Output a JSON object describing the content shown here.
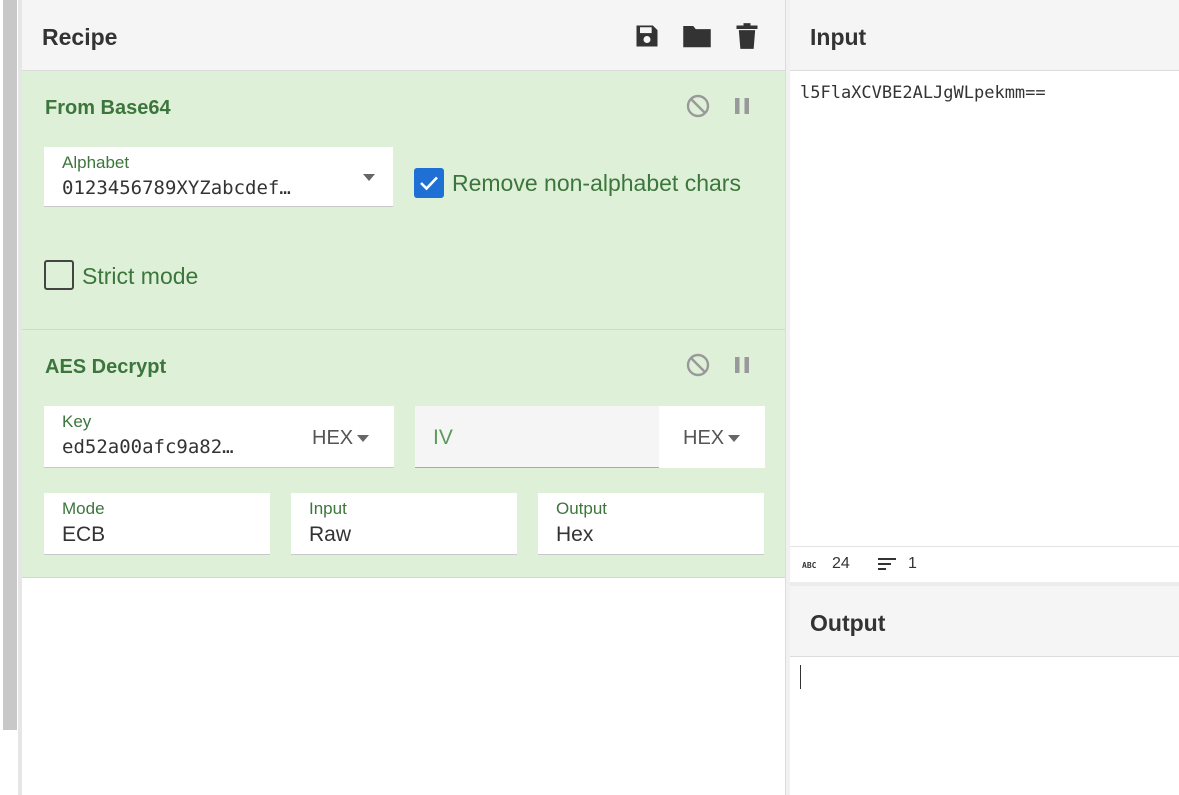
{
  "recipe": {
    "title": "Recipe",
    "icons": [
      "save-icon",
      "folder-icon",
      "trash-icon"
    ],
    "operations": [
      {
        "name": "From Base64",
        "alphabet_label": "Alphabet",
        "alphabet_value": "0123456789XYZabcdef…",
        "remove_label": "Remove non-alphabet chars",
        "remove_checked": true,
        "strict_label": "Strict mode",
        "strict_checked": false
      },
      {
        "name": "AES Decrypt",
        "key_label": "Key",
        "key_value": "ed52a00afc9a82…",
        "key_format": "HEX",
        "iv_placeholder": "IV",
        "iv_format": "HEX",
        "mode_label": "Mode",
        "mode_value": "ECB",
        "input_label": "Input",
        "input_value": "Raw",
        "output_label": "Output",
        "output_value": "Hex"
      }
    ]
  },
  "input": {
    "title": "Input",
    "text": "l5FlaXCVBE2ALJgWLpekmm==",
    "char_count": "24",
    "line_count": "1"
  },
  "output": {
    "title": "Output"
  },
  "colors": {
    "op_bg": "#dff0d8",
    "op_text": "#3c763d",
    "checkbox": "#1f70d4"
  }
}
